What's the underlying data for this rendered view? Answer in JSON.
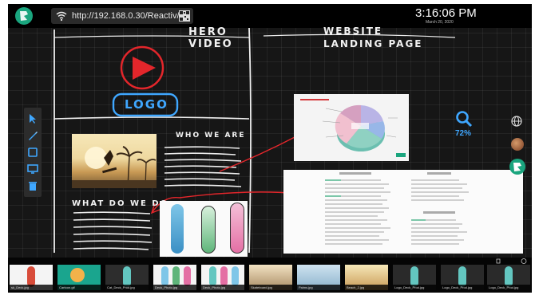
{
  "topbar": {
    "url": "http://192.168.0.30/Reactiv/",
    "time": "3:16:06 PM",
    "date": "March 20, 2020"
  },
  "canvas": {
    "hero_video": "HERO VIDEO",
    "landing_page": "WEBSITE LANDING PAGE",
    "logo_text": "LOGO",
    "who_we_are": "WHO WE ARE",
    "what_do_we_do": "WHAT DO WE DO"
  },
  "zoom": {
    "level": "72%"
  },
  "filmstrip": {
    "thumbs": [
      {
        "label": "sk_Deck.jpg"
      },
      {
        "label": "Cartoon.gif"
      },
      {
        "label": "Cat_Deck_Prod.jpg"
      },
      {
        "label": "Deck_Photo.jpg"
      },
      {
        "label": "Deck_Photo.jpg"
      },
      {
        "label": "Skateboard.jpg"
      },
      {
        "label": "Palms.jpg"
      },
      {
        "label": "Beach_2.jpg"
      },
      {
        "label": "Logo_Deck_Prod.jpg"
      },
      {
        "label": "Logo_Deck_Prod.jpg"
      },
      {
        "label": "Logo_Deck_Prod.jpg"
      }
    ]
  },
  "colors": {
    "accent_blue": "#3fa7ff",
    "ink_red": "#e3262b",
    "logo_green": "#1aa57e"
  }
}
